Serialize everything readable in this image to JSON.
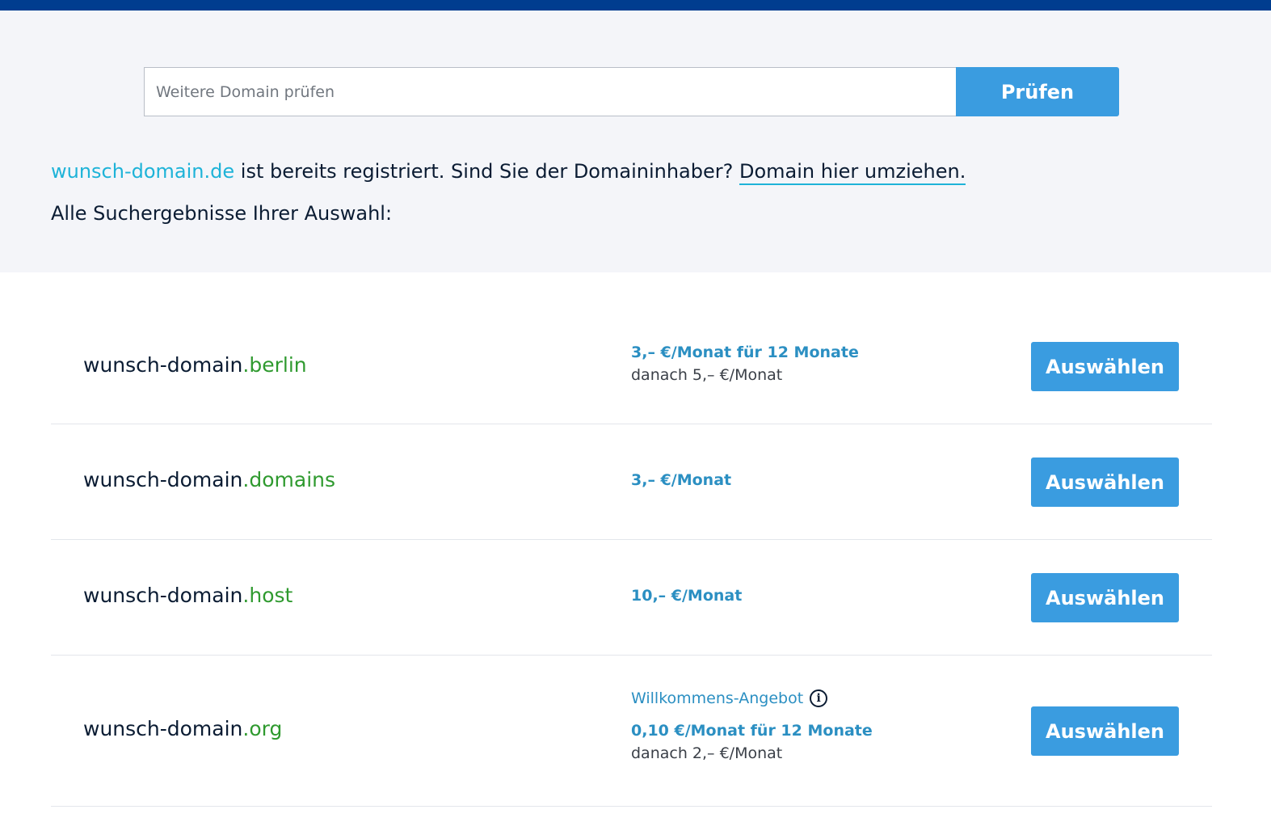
{
  "search": {
    "placeholder": "Weitere Domain prüfen",
    "value": "",
    "button_label": "Prüfen"
  },
  "status": {
    "domain": "wunsch-domain.de",
    "message": " ist bereits registriert. Sind Sie der Domaininhaber? ",
    "transfer_link": "Domain hier umziehen."
  },
  "results_heading": "Alle Suchergebnisse Ihrer Auswahl:",
  "results": [
    {
      "base": "wunsch-domain",
      "tld": ".berlin",
      "price_main": "3,– €/Monat für 12 Monate",
      "price_after": "danach 5,– €/Monat",
      "button_label": "Auswählen"
    },
    {
      "base": "wunsch-domain",
      "tld": ".domains",
      "price_main": "3,– €/Monat",
      "button_label": "Auswählen"
    },
    {
      "base": "wunsch-domain",
      "tld": ".host",
      "price_main": "10,– €/Monat",
      "button_label": "Auswählen"
    },
    {
      "base": "wunsch-domain",
      "tld": ".org",
      "offer": "Willkommens-Angebot",
      "price_main": "0,10 €/Monat für 12 Monate",
      "price_after": "danach 2,– €/Monat",
      "button_label": "Auswählen"
    }
  ],
  "colors": {
    "topbar": "#003d8f",
    "accent_button": "#3a9ce0",
    "domain_link": "#1eb3d8",
    "tld_green": "#2f9a2f",
    "price_blue": "#2b8fc2"
  },
  "icons": {
    "offer_info": "info-icon"
  }
}
